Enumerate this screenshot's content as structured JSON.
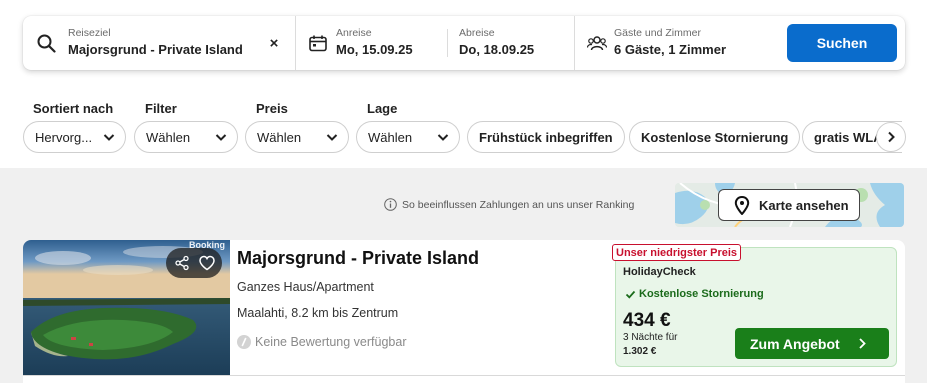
{
  "search": {
    "destination_label": "Reiseziel",
    "destination_value": "Majorsgrund - Private Island",
    "clear_symbol": "×",
    "checkin_label": "Anreise",
    "checkin_value": "Mo, 15.09.25",
    "checkout_label": "Abreise",
    "checkout_value": "Do, 18.09.25",
    "guests_label": "Gäste und Zimmer",
    "guests_value": "6 Gäste, 1 Zimmer",
    "search_button": "Suchen",
    "icons": [
      "search-icon",
      "calendar-icon",
      "guests-icon"
    ]
  },
  "filters": {
    "sort_label": "Sortiert nach",
    "sort_value": "Hervorg...",
    "filter_label": "Filter",
    "filter_value": "Wählen",
    "price_label": "Preis",
    "price_value": "Wählen",
    "location_label": "Lage",
    "location_value": "Wählen",
    "chips": [
      "Frühstück inbegriffen",
      "Kostenlose Stornierung",
      "gratis WLAN"
    ]
  },
  "ranking_note": "So beeinflussen Zahlungen an uns unser Ranking",
  "map_button": "Karte ansehen",
  "result": {
    "photo_watermark": "Booking",
    "title": "Majorsgrund - Private Island",
    "type": "Ganzes Haus/Apartment",
    "location": "Maalahti, 8.2 km bis Zentrum",
    "rating": "Keine Bewertung verfügbar",
    "offer": {
      "badge": "Unser niedrigster Preis",
      "provider": "HolidayCheck",
      "cancellation": "Kostenlose Stornierung",
      "price": "434 €",
      "nights": "3 Nächte für",
      "total": "1.302 €",
      "button": "Zum Angebot"
    }
  },
  "colors": {
    "primary_blue": "#0a6ccc",
    "deal_green": "#1a7f1a",
    "offer_bg": "#e9f6e9",
    "badge_red": "#c8102e"
  }
}
